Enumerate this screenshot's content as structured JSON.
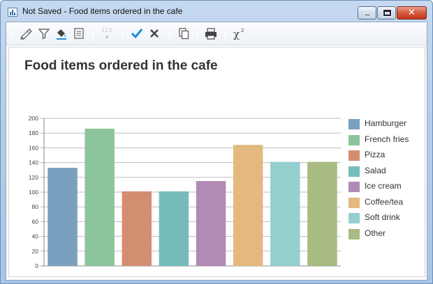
{
  "window": {
    "title": "Not Saved - Food items ordered in the cafe",
    "close_glyph": "✕"
  },
  "toolbar": {
    "buttons": [
      {
        "name": "edit-icon"
      },
      {
        "name": "filter-icon"
      },
      {
        "name": "fill-color-icon"
      },
      {
        "name": "notes-icon"
      },
      {
        "name": "number-format-icon",
        "label": "123",
        "enabled": false
      },
      {
        "name": "check-icon"
      },
      {
        "name": "cancel-icon"
      },
      {
        "name": "copy-icon"
      },
      {
        "name": "print-icon"
      },
      {
        "name": "chi-square-icon",
        "label": "χ",
        "sup": "2"
      }
    ]
  },
  "chart_data": {
    "type": "bar",
    "title": "Food items ordered in the cafe",
    "categories": [
      "Hamburger",
      "French fries",
      "Pizza",
      "Salad",
      "Ice cream",
      "Coffee/tea",
      "Soft drink",
      "Other"
    ],
    "values": [
      133,
      186,
      101,
      101,
      115,
      164,
      141,
      141
    ],
    "colors": [
      "#7aa0bf",
      "#8ec49b",
      "#d38e72",
      "#77bcbd",
      "#b18bb4",
      "#e3b97f",
      "#95cfcf",
      "#a7bb82"
    ],
    "yticks": [
      0,
      20,
      40,
      60,
      80,
      100,
      120,
      140,
      160,
      180,
      200
    ],
    "ylim": [
      0,
      200
    ],
    "grid": true,
    "legend": "right"
  }
}
